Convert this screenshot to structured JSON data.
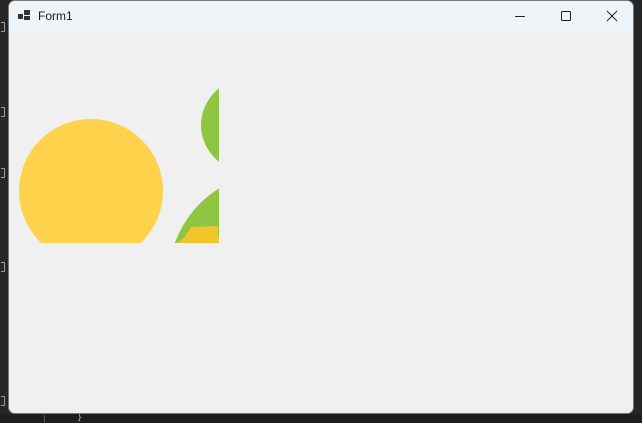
{
  "window": {
    "title": "Form1"
  },
  "titlebar_buttons": {
    "minimize": "minimize",
    "maximize": "maximize",
    "close": "close"
  },
  "picture": {
    "colors": {
      "sun": "#fed24a",
      "leaf": "#8fc641",
      "inner": "#f2c52a",
      "background": "#f0f0f0"
    }
  },
  "background_editor": {
    "bottom_glyph": "}"
  }
}
